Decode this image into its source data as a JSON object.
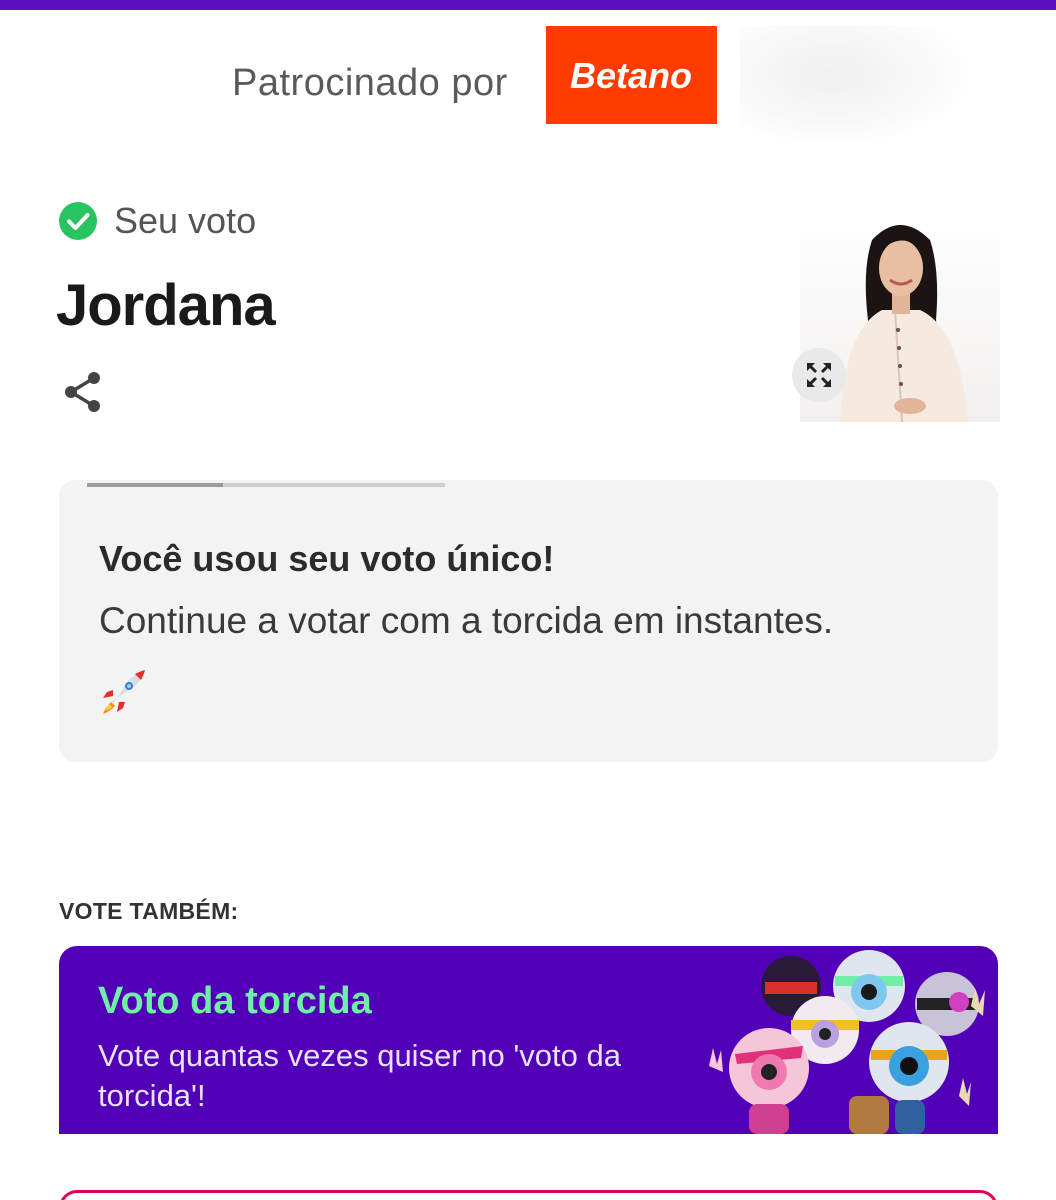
{
  "colors": {
    "top_bar": "#5b0fc0",
    "betano_bg": "#ff3b00",
    "check": "#27c45f",
    "torcida_bg": "#5200b8",
    "torcida_title": "#6ff0a6",
    "next_card_border": "#e0005a"
  },
  "sponsor": {
    "label": "Patrocinado por",
    "brand": "Betano"
  },
  "vote": {
    "status_label": "Seu voto",
    "status_icon": "check-circle-icon",
    "candidate": "Jordana",
    "share_icon": "share-icon",
    "expand_icon": "expand-icon"
  },
  "info_card": {
    "title": "Você usou seu voto único!",
    "text": "Continue a votar com a torcida em instantes.",
    "emoji_icon": "rocket-icon",
    "progress": 0.38
  },
  "vote_also": {
    "heading": "VOTE TAMBÉM:",
    "card": {
      "title": "Voto da torcida",
      "description": "Vote quantas vezes quiser no 'voto da torcida'!"
    }
  }
}
